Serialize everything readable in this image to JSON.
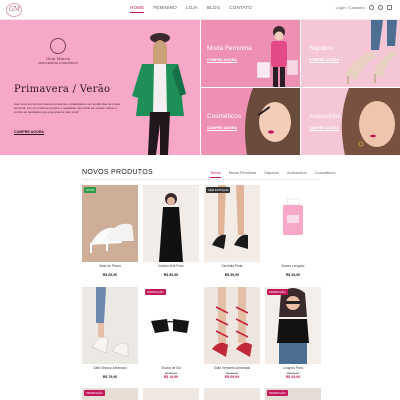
{
  "header": {
    "logo_text": "GM",
    "nav": [
      {
        "label": "HOME",
        "active": true
      },
      {
        "label": "FEMININO",
        "active": false
      },
      {
        "label": "LOJA",
        "active": false
      },
      {
        "label": "BLOG",
        "active": false
      },
      {
        "label": "CONTATO",
        "active": false
      }
    ],
    "login_label": "Login / Cadastro"
  },
  "hero": {
    "brand": "Gina Moura",
    "brand_tag": "MODA FEMININA & ACESSÓRIOS",
    "title": "Primavera / Verão",
    "description": "Aqui você encontra produtos exclusivos e atualizados com tendências de moda feminina, com os melhores preços e qualidade. Aproveite as nossas ofertas e confira as novidades que preparamos para você!",
    "cta": "COMPRE AGORA"
  },
  "categories": [
    {
      "label": "Moda Feminina",
      "cta": "COMPRE AGORA"
    },
    {
      "label": "Sapatos",
      "cta": "COMPRE AGORA"
    },
    {
      "label": "Cosméticos",
      "cta": "COMPRE AGORA"
    },
    {
      "label": "Acessórios",
      "cta": "COMPRE AGORA"
    }
  ],
  "new_products": {
    "title": "NOVOS PRODUTOS",
    "tabs": [
      {
        "label": "Todos",
        "active": true
      },
      {
        "label": "Moda Feminina",
        "active": false
      },
      {
        "label": "Sapatos",
        "active": false
      },
      {
        "label": "Acessórios",
        "active": false
      },
      {
        "label": "Cosméticos",
        "active": false
      }
    ],
    "products": [
      {
        "name": "Salto de Pluma",
        "old_price": "",
        "price": "R$ 69,90",
        "badge": "NOVO",
        "badge_color": "#2e9b4a"
      },
      {
        "name": "Vestido Midi Preto",
        "old_price": "",
        "price": "R$ 89,90",
        "badge": "",
        "badge_color": ""
      },
      {
        "name": "Sandália Preta",
        "old_price": "",
        "price": "R$ 59,90",
        "badge": "SEM ESTOQUE",
        "badge_color": "#333333"
      },
      {
        "name": "Bruma Lengado",
        "old_price": "",
        "price": "R$ 49,90",
        "badge": "",
        "badge_color": ""
      },
      {
        "name": "Salto Branco Amarrado",
        "old_price": "",
        "price": "R$ 79,90",
        "badge": "",
        "badge_color": ""
      },
      {
        "name": "Óculos de Sol",
        "old_price": "R$ 59,90",
        "price": "R$ 19,90",
        "badge": "PROMOÇÃO",
        "badge_color": "#c2185b"
      },
      {
        "name": "Salto Vermelho Amarrado",
        "old_price": "R$ 89,90",
        "price": "R$ 69,90",
        "badge": "",
        "badge_color": ""
      },
      {
        "name": "Cropped Preto",
        "old_price": "R$ 49,90",
        "price": "R$ 39,90",
        "badge": "PROMOÇÃO",
        "badge_color": "#c2185b"
      }
    ],
    "row3_badges": [
      {
        "badge": "PROMOÇÃO",
        "badge_color": "#c2185b"
      },
      {
        "badge": "",
        "badge_color": ""
      },
      {
        "badge": "",
        "badge_color": ""
      },
      {
        "badge": "PROMOÇÃO",
        "badge_color": "#c2185b"
      }
    ]
  }
}
